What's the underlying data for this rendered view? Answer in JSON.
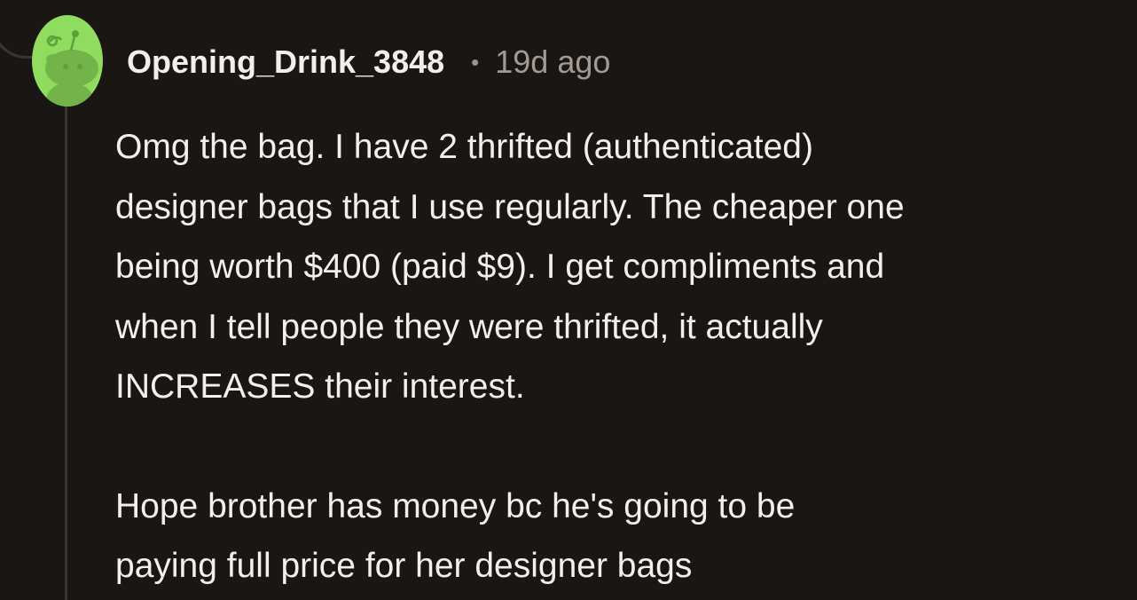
{
  "comment": {
    "author": "Opening_Drink_3848",
    "separator": "•",
    "timestamp": "19d ago",
    "avatar_icon": "snoo-avatar-icon",
    "body": {
      "paragraph_1_lines": [
        "Omg the bag. I have 2 thrifted (authenticated)",
        "designer bags that I use regularly. The cheaper one",
        "being worth $400 (paid $9). I get compliments and",
        "when I tell people they were thrifted, it actually",
        "INCREASES their interest."
      ],
      "paragraph_2_lines": [
        "Hope brother has money bc he's going to be",
        "paying full price for her designer bags"
      ]
    }
  },
  "colors": {
    "background": "#1a1614",
    "avatar_green": "#8fdc5e",
    "text": "#f2efec",
    "muted_text": "#a39a94",
    "thread_line": "#3a3533"
  }
}
